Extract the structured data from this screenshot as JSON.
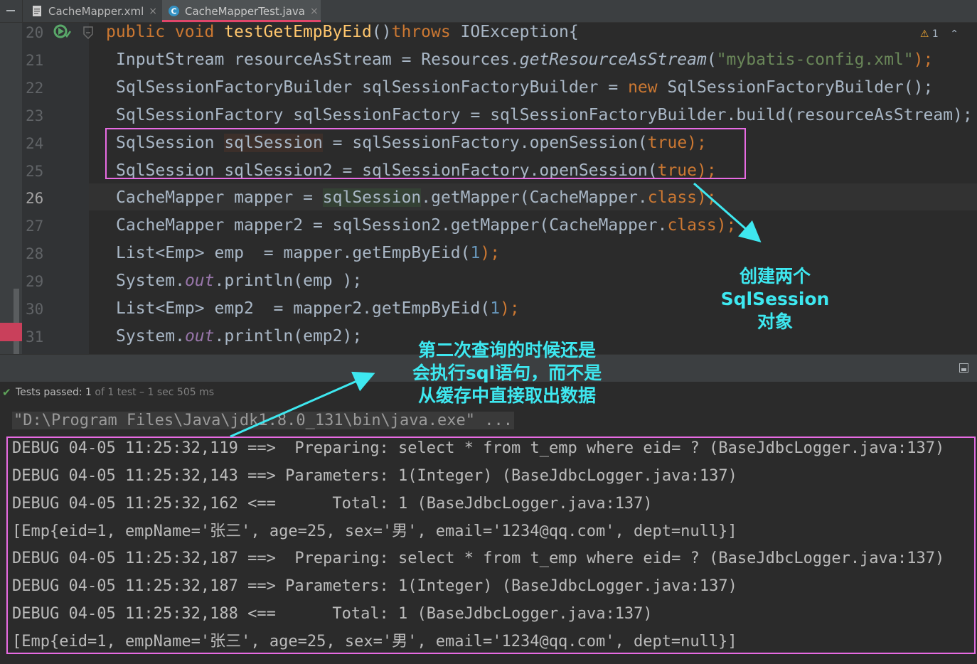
{
  "tabs": [
    {
      "label": "CacheMapper.xml",
      "close": "×"
    },
    {
      "label": "CacheMapperTest.java",
      "close": "×"
    }
  ],
  "editor": {
    "warnings": "1",
    "lines": [
      {
        "no": "20"
      },
      {
        "no": "21"
      },
      {
        "no": "22"
      },
      {
        "no": "23"
      },
      {
        "no": "24"
      },
      {
        "no": "25"
      },
      {
        "no": "26"
      },
      {
        "no": "27"
      },
      {
        "no": "28"
      },
      {
        "no": "29"
      },
      {
        "no": "30"
      },
      {
        "no": "31"
      }
    ],
    "code": {
      "l20": {
        "a": "public void ",
        "fn": "testGetEmpByEid",
        "b": "()",
        "kw": "throws",
        "c": " IOException{"
      },
      "l21": {
        "a": "InputStream resourceAsStream = Resources.",
        "it": "getResourceAsStream",
        "b": "(",
        "str": "\"mybatis-config.xml\"",
        "c": ");"
      },
      "l22": {
        "a": "SqlSessionFactoryBuilder sqlSessionFactoryBuilder = ",
        "kw": "new",
        "b": " SqlSessionFactoryBuilder();"
      },
      "l23": {
        "a": "SqlSessionFactory sqlSessionFactory = sqlSessionFactoryBuilder.build(resourceAsStream);"
      },
      "l24": {
        "a": "SqlSession ",
        "var": "sqlSession",
        "b": " = sqlSessionFactory.openSession(",
        "kw": "true",
        "c": ");"
      },
      "l25": {
        "a": "SqlSession sqlSession2 = sqlSessionFactory.openSession(",
        "kw": "true",
        "c": ");"
      },
      "l26": {
        "a": "CacheMapper mapper = ",
        "var": "sqlSession",
        "b": ".getMapper(CacheMapper.",
        "kw": "class",
        "c": ");"
      },
      "l27": {
        "a": "CacheMapper mapper2 = sqlSession2.getMapper(CacheMapper.",
        "kw": "class",
        "c": ");"
      },
      "l28": {
        "a": "List<Emp> emp  = mapper.getEmpByEid(",
        "num": "1",
        "c": ");"
      },
      "l29": {
        "a": "System.",
        "fld": "out",
        "b": ".println(emp );"
      },
      "l30": {
        "a": "List<Emp> emp2  = mapper2.getEmpByEid(",
        "num": "1",
        "c": ");"
      },
      "l31": {
        "a": "System.",
        "fld": "out",
        "b": ".println(emp2);"
      }
    }
  },
  "tests": {
    "check": "✔",
    "passed_label": "Tests passed: ",
    "count": "1",
    "rest": " of 1 test – 1 sec 505 ms"
  },
  "console": {
    "cmd": "\"D:\\Program Files\\Java\\jdk1.8.0_131\\bin\\java.exe\" ...",
    "lines": [
      "DEBUG 04-05 11:25:32,119 ==>  Preparing: select * from t_emp where eid= ? (BaseJdbcLogger.java:137)",
      "DEBUG 04-05 11:25:32,143 ==> Parameters: 1(Integer) (BaseJdbcLogger.java:137)",
      "DEBUG 04-05 11:25:32,162 <==      Total: 1 (BaseJdbcLogger.java:137)",
      "[Emp{eid=1, empName='张三', age=25, sex='男', email='1234@qq.com', dept=null}]",
      "DEBUG 04-05 11:25:32,187 ==>  Preparing: select * from t_emp where eid= ? (BaseJdbcLogger.java:137)",
      "DEBUG 04-05 11:25:32,187 ==> Parameters: 1(Integer) (BaseJdbcLogger.java:137)",
      "DEBUG 04-05 11:25:32,188 <==      Total: 1 (BaseJdbcLogger.java:137)",
      "[Emp{eid=1, empName='张三', age=25, sex='男', email='1234@qq.com', dept=null}]"
    ]
  },
  "annotations": {
    "note1": [
      "创建两个",
      "SqlSession",
      "对象"
    ],
    "note2": [
      "第二次查询的时候还是",
      "会执行sql语句，而不是",
      "从缓存中直接取出数据"
    ],
    "accent": "#3ee8f0",
    "box_color": "#e86be3"
  }
}
